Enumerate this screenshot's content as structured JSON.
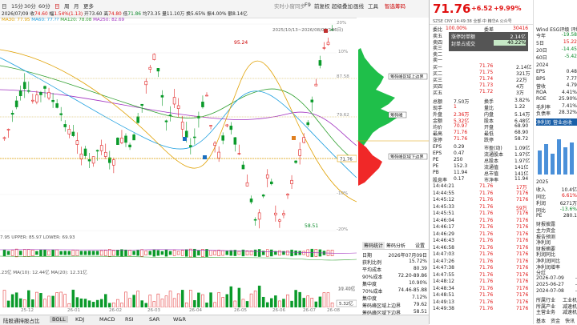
{
  "toolbar": {
    "periods": [
      "日",
      "15分",
      "30分",
      "60分",
      "日",
      "周",
      "月",
      "更多"
    ],
    "tools": [
      "实时小窗同步",
      "F9",
      "前复权",
      "超级叠加",
      "画线",
      "工具"
    ],
    "right_label": "智选筹码"
  },
  "ohlc": {
    "date": "2026/07/09",
    "open_label": "收",
    "open": "74.60",
    "change_label": "幅",
    "change": "1.54%(1.13)",
    "high_label": "开",
    "high": "73.60",
    "hi_label": "高",
    "hi": "74.80",
    "lo_label": "低",
    "lo": "71.86",
    "close_label": "均",
    "close": "73.35",
    "vol_label": "量",
    "vol": "11.10万",
    "turn_label": "换",
    "turn": "5.65%",
    "amp_label": "振",
    "amp": "4.00%",
    "amt_label": "额",
    "amt": "8.14亿"
  },
  "ma": {
    "ma30": "MA30: 77.95",
    "ma60": "MA60: 77.??",
    "ma120": "MA120: 78.08",
    "ma250": "MA250: 82.69"
  },
  "chart_labels": {
    "range": "2025/10/13~2026/08/03(186日)",
    "high_mark": "95.24",
    "low_mark": "58.51",
    "current_price": "71.76",
    "pct_ticks": [
      "10%",
      "0%",
      "-10%",
      "-20%"
    ],
    "pct_top": "20%",
    "price_ticks": [
      "87.58",
      "79.62"
    ],
    "x_dates": [
      "25-12",
      "26-01",
      "26-02",
      "26-03",
      "26-04",
      "26-05",
      "26-06",
      "26-07",
      "26-08"
    ]
  },
  "boll": {
    "line": "7.95  UPPER: 85.97  LOWER: 69.93"
  },
  "vol": {
    "line": ".23亿  MA(10): 12.44亿  MA(20): 12.31亿",
    "ticks": [
      "21.40亿",
      "10.70亿"
    ],
    "cur": "5.32亿"
  },
  "chip_labels": {
    "upper": "筹码峰区域上边界",
    "peak": "筹码峰",
    "lower": "筹码峰区域下边界",
    "price": "71.76"
  },
  "chip_tabs": [
    "筹码统计",
    "筹码分析",
    "设置"
  ],
  "chip_info": [
    {
      "label": "日期",
      "value": "2026年07月09日"
    },
    {
      "label": "获利比例",
      "value": "15.72%"
    },
    {
      "label": "平均成本",
      "value": "80.39"
    },
    {
      "label": "90%成本",
      "value": "72.20-89.86"
    },
    {
      "label": "集中度",
      "value": "10.90%"
    },
    {
      "label": "70%成本",
      "value": "74.46-85.88"
    },
    {
      "label": "集中度",
      "value": "7.12%"
    },
    {
      "label": "筹码峰区域上边界",
      "value": "79.62"
    },
    {
      "label": "筹码峰区域下边界",
      "value": "58.51"
    }
  ],
  "bottom_tabs": [
    "陆股通持股占比",
    "BOLL",
    "KDJ",
    "MACD",
    "RSI",
    "SAR",
    "W&R"
  ],
  "quote": {
    "price": "71.76",
    "change": "+6.52",
    "pct": "+9.99%",
    "subtitle": "SZSE CNY  14:49:38  全部·中  精华A 公众号",
    "stat_header": [
      {
        "label": "委比",
        "value": "100.00%"
      },
      {
        "label": "委差",
        "value": "30416"
      }
    ],
    "sell": [
      {
        "label": "卖五",
        "price": "",
        "vol": ""
      },
      {
        "label": "卖四",
        "price": "",
        "vol": ""
      },
      {
        "label": "卖三",
        "price": "",
        "vol": ""
      },
      {
        "label": "卖二",
        "price": "",
        "vol": ""
      },
      {
        "label": "卖一",
        "price": "",
        "vol": ""
      }
    ],
    "popup": [
      {
        "label": "涨停封单额",
        "value": "2.14亿"
      },
      {
        "label": "封单占成交",
        "value": "40.22%"
      }
    ],
    "buy": [
      {
        "label": "买一",
        "price": "71.76",
        "vol": "2.14亿"
      },
      {
        "label": "买二",
        "price": "71.75",
        "vol": "321万"
      },
      {
        "label": "买三",
        "price": "71.74",
        "vol": "22万"
      },
      {
        "label": "买四",
        "price": "71.73",
        "vol": "4万"
      },
      {
        "label": "买五",
        "price": "71.72",
        "vol": "3万"
      }
    ],
    "stats": [
      {
        "l1": "总额",
        "v1": "7.50万",
        "l2": "换手",
        "v2": "3.82%"
      },
      {
        "l1": "现手",
        "v1": "1",
        "l2": "量比",
        "v2": "1.22"
      },
      {
        "l1": "外盘",
        "v1": "2.36万",
        "l2": "内盘",
        "v2": "5.14万"
      },
      {
        "l1": "金额",
        "v1": "5.32亿",
        "l2": "股本",
        "v2": "6.48亿"
      },
      {
        "l1": "均价",
        "v1": "70.97",
        "l2": "开盘",
        "v2": "68.90"
      },
      {
        "l1": "最高",
        "v1": "71.76",
        "l2": "最低",
        "v2": "68.90"
      },
      {
        "l1": "涨停",
        "v1": "71.76",
        "l2": "跌停",
        "v2": "58.72"
      }
    ],
    "fund": [
      {
        "l1": "EPS",
        "v1": "0.29",
        "l2": "市盈(动)",
        "v2": "1.09亿"
      },
      {
        "l1": "EPS",
        "v1": "0.47",
        "l2": "流通股本",
        "v2": "1.97亿"
      },
      {
        "l1": "PE",
        "v1": "250",
        "l2": "总股本",
        "v2": "1.97亿"
      },
      {
        "l1": "PE",
        "v1": "152.3",
        "l2": "流通值",
        "v2": "141亿"
      },
      {
        "l1": "PB",
        "v1": "11.94",
        "l2": "总市值",
        "v2": "141亿"
      },
      {
        "l1": "股息率",
        "v1": "0.17",
        "l2": "市净率",
        "v2": "11.94"
      }
    ],
    "ticks": [
      {
        "t": "14:44:21",
        "p": "71.76",
        "v": "17万"
      },
      {
        "t": "14:44:55",
        "p": "71.76",
        "v": "7176"
      },
      {
        "t": "14:45:12",
        "p": "71.76",
        "v": "7176"
      },
      {
        "t": "14:45:33",
        "p": "71.76",
        "v": "59万"
      },
      {
        "t": "14:45:51",
        "p": "71.76",
        "v": "7176"
      },
      {
        "t": "14:46:04",
        "p": "71.76",
        "v": "7176"
      },
      {
        "t": "14:46:17",
        "p": "71.76",
        "v": "7176"
      },
      {
        "t": "14:46:29",
        "p": "71.76",
        "v": "7176"
      },
      {
        "t": "14:46:43",
        "p": "71.76",
        "v": "7176"
      },
      {
        "t": "14:46:58",
        "p": "71.76",
        "v": "7176"
      },
      {
        "t": "14:47:03",
        "p": "71.76",
        "v": "7176"
      },
      {
        "t": "14:47:26",
        "p": "71.76",
        "v": "7176"
      },
      {
        "t": "14:47:38",
        "p": "71.76",
        "v": "7176"
      },
      {
        "t": "14:47:55",
        "p": "71.76",
        "v": "7176"
      },
      {
        "t": "14:48:12",
        "p": "71.76",
        "v": "7176"
      },
      {
        "t": "14:48:34",
        "p": "71.76",
        "v": "7176"
      },
      {
        "t": "14:48:51",
        "p": "71.76",
        "v": "7176"
      },
      {
        "t": "14:49:13",
        "p": "71.76",
        "v": "7176"
      },
      {
        "t": "14:49:38",
        "p": "71.76",
        "v": "7176"
      }
    ]
  },
  "rightstrip": {
    "tabs": [
      "Wind",
      "ESG评级",
      "评级"
    ],
    "perf": [
      {
        "l": "今年",
        "v": "-19.58"
      },
      {
        "l": "5日",
        "v": "15.22"
      },
      {
        "l": "20日",
        "v": "-14.45"
      },
      {
        "l": "60日",
        "v": "-5.42"
      }
    ],
    "year": "2024",
    "fin": [
      {
        "l": "EPS",
        "v": "0.48"
      },
      {
        "l": "BPS",
        "v": "7.77"
      },
      {
        "l": "营收",
        "v": "4.79"
      },
      {
        "l": "ROA",
        "v": "4.41%"
      },
      {
        "l": "ROE",
        "v": "25.90%"
      },
      {
        "l": "毛利率",
        "v": "7.41%"
      },
      {
        "l": "负债率",
        "v": "28.32%"
      }
    ],
    "tabs2": [
      "净利润",
      "营业总收"
    ],
    "year2": "2025",
    "fin2": [
      {
        "l": "收入",
        "v": "10.4亿"
      },
      {
        "l": "同比",
        "v": "6.61%"
      },
      {
        "l": "利润",
        "v": "6271万"
      },
      {
        "l": "同比",
        "v": "-13.6%"
      },
      {
        "l": "PE",
        "v": "280.1"
      }
    ],
    "reports_title": "财报披露",
    "reports": [
      "主力资金",
      "报告预测",
      "净利润",
      "财报摘要",
      "利润同比",
      "净利润同比",
      "净利润增率"
    ],
    "dividend_title": "分红",
    "dividends": [
      {
        "d": "2026-07-09",
        "v": "-"
      },
      {
        "d": "2025-06-27",
        "v": "-"
      },
      {
        "d": "2024-07-08",
        "v": "-"
      }
    ],
    "industry": [
      {
        "l": "所属行业",
        "v": "工业机"
      },
      {
        "l": "所属产业",
        "v": "减速机"
      },
      {
        "l": "主营业务",
        "v": "减速机"
      }
    ],
    "bottom_tabs": [
      "基本",
      "资金",
      "快讯"
    ]
  }
}
